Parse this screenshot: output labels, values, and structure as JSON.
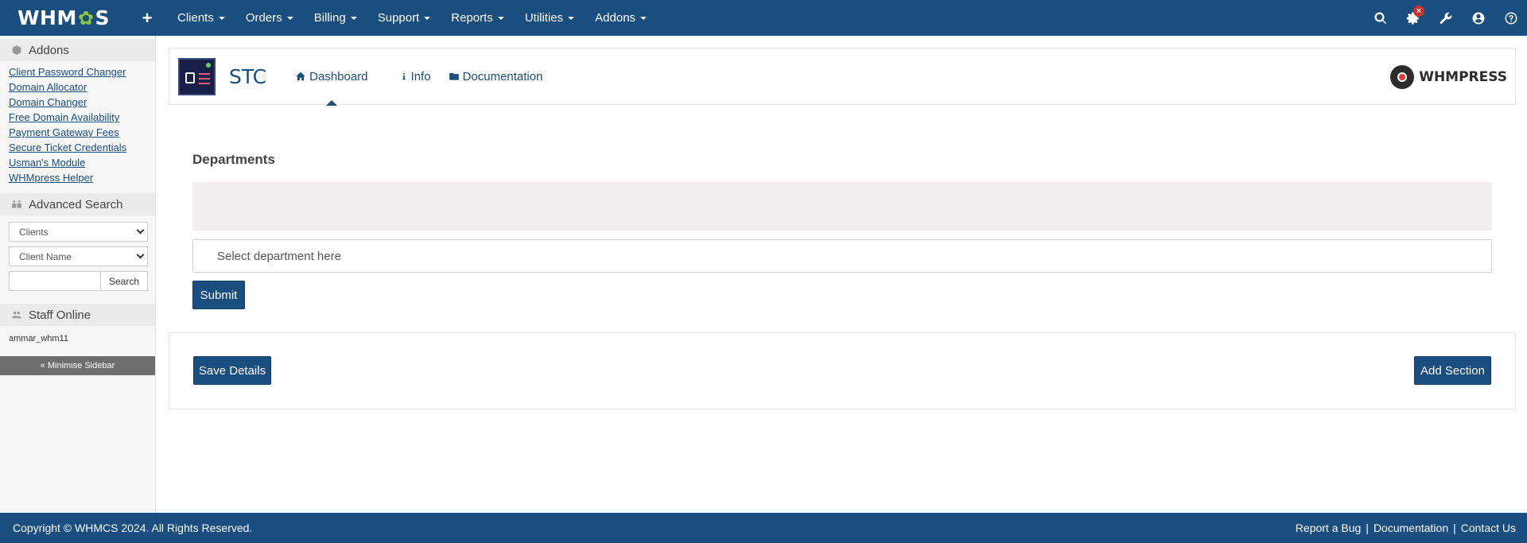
{
  "topbar": {
    "logo_prefix": "WHM",
    "logo_gear": "✿",
    "logo_suffix": "S",
    "plus_symbol": "+",
    "menu": [
      {
        "label": "Clients"
      },
      {
        "label": "Orders"
      },
      {
        "label": "Billing"
      },
      {
        "label": "Support"
      },
      {
        "label": "Reports"
      },
      {
        "label": "Utilities"
      },
      {
        "label": "Addons"
      }
    ],
    "badge_symbol": "×",
    "icons": [
      "search-icon",
      "cogs-icon",
      "wrench-icon",
      "user-circle-icon",
      "help-icon"
    ],
    "brand_color": "#1a4d80"
  },
  "sidebar": {
    "addons_title": "Addons",
    "addons_links": [
      "Client Password Changer",
      "Domain Allocator",
      "Domain Changer",
      "Free Domain Availability",
      "Payment Gateway Fees",
      "Secure Ticket Credentials",
      "Usman's Module",
      "WHMpress Helper"
    ],
    "search_title": "Advanced Search",
    "search_type": "Clients",
    "search_field": "Client Name",
    "search_value": "",
    "search_button": "Search",
    "staff_title": "Staff Online",
    "staff_user": "ammar_whm11",
    "minimise_label": "« Minimise Sidebar"
  },
  "main": {
    "app_title": "STC",
    "tabs": [
      {
        "label": "Dashboard",
        "icon": "home-icon",
        "active": true
      },
      {
        "label": "Info",
        "icon": "info-icon"
      },
      {
        "label": "Documentation",
        "icon": "folder-icon"
      }
    ],
    "brand_name": "WHMPRESS",
    "departments_title": "Departments",
    "select_placeholder": "Select department here",
    "submit_label": "Submit",
    "save_label": "Save Details",
    "add_section_label": "Add Section"
  },
  "footer": {
    "copyright": "Copyright © WHMCS 2024. All Rights Reserved.",
    "links": [
      "Report a Bug",
      "Documentation",
      "Contact Us"
    ],
    "separator": "|"
  }
}
